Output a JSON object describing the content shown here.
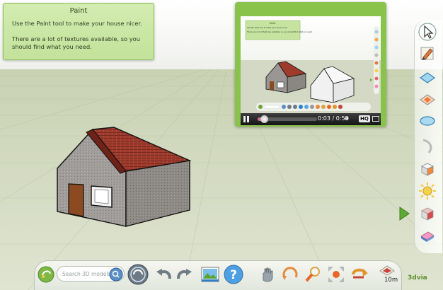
{
  "tutorial": {
    "title": "Paint",
    "line1": "Use the Paint tool to make your house nicer.",
    "line2": "There are a lot of textures available, so you should find what you need."
  },
  "video": {
    "time": "0:03 / 0:50",
    "progress": 0.06,
    "hq_label": "HQ",
    "inner_tutorial": {
      "title": "Paint",
      "line1": "Use the Paint tool to make your house nicer.",
      "line2": "There are a lot of textures available, so you should find what you need."
    }
  },
  "toolbar": {
    "search_placeholder": "Search 3D models",
    "distance_value": "10m",
    "brand": "3dvia"
  },
  "icons": {
    "tools": [
      "select-arrow-icon",
      "paint-icon",
      "draw-rectangle-icon",
      "draw-triangle-icon",
      "draw-ellipse-icon",
      "draw-arc-icon",
      "extrude-box-icon",
      "snap-icon",
      "cube-texture-icon",
      "eraser-icon"
    ],
    "bottom": [
      "home-icon",
      "search-icon",
      "catalog-icon",
      "undo-icon",
      "redo-icon",
      "photo-icon",
      "help-icon",
      "hand-icon",
      "orbit-icon",
      "zoom-icon",
      "fit-view-icon",
      "measure-icon",
      "ground-measure-icon"
    ]
  },
  "colors": {
    "panel_green": "#c3e29a",
    "video_frame_green": "#8ac34b",
    "roof": "#9e3b2d",
    "wall": "#9a9694",
    "door": "#8b4a1f"
  }
}
